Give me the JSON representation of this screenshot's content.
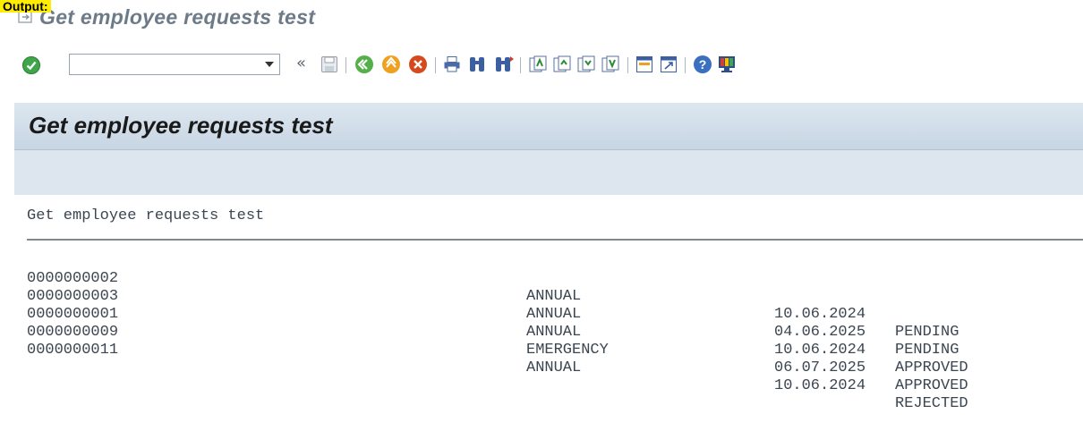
{
  "highlight_label": "Output:",
  "window": {
    "title": "Get employee requests test"
  },
  "toolbar": {
    "command_value": "",
    "icons": [
      "enter-check",
      "back-double-arrow",
      "save",
      "back-green",
      "exit-orange",
      "cancel-red",
      "print",
      "find",
      "find-next",
      "first-page",
      "previous-page",
      "next-page",
      "last-page",
      "create-session",
      "shortcut",
      "help",
      "customize-layout"
    ]
  },
  "content": {
    "title": "Get employee requests test",
    "list_header": "Get employee requests test",
    "rows": [
      {
        "id": "0000000002",
        "type": "ANNUAL",
        "date": "10.06.2024",
        "status": "PENDING"
      },
      {
        "id": "0000000003",
        "type": "ANNUAL",
        "date": "04.06.2025",
        "status": "PENDING"
      },
      {
        "id": "0000000001",
        "type": "ANNUAL",
        "date": "10.06.2024",
        "status": "APPROVED"
      },
      {
        "id": "0000000009",
        "type": "EMERGENCY",
        "date": "06.07.2025",
        "status": "APPROVED"
      },
      {
        "id": "0000000011",
        "type": "ANNUAL",
        "date": "10.06.2024",
        "status": "REJECTED"
      }
    ]
  },
  "colors": {
    "header_gradient_top": "#dde7f0",
    "header_gradient_bottom": "#c7d5e3",
    "appbar": "#dde5ee",
    "highlight": "#ffee00"
  }
}
